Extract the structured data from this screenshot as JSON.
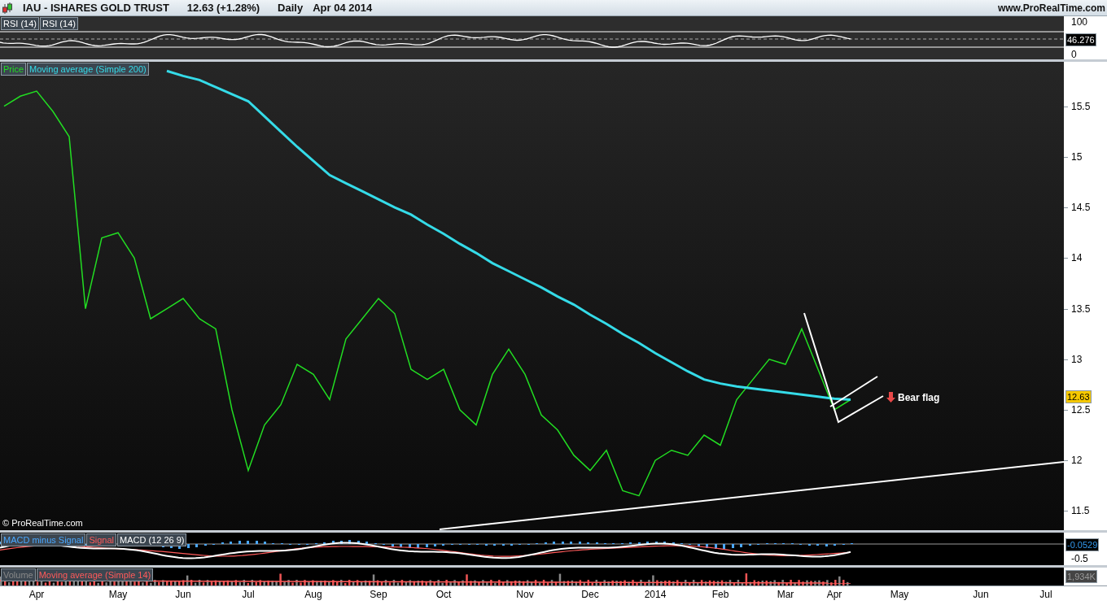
{
  "header": {
    "symbol": "IAU - ISHARES GOLD TRUST",
    "quote": "12.63 (+1.28%)",
    "period": "Daily",
    "date": "Apr 04 2014",
    "site": "www.ProRealTime.com"
  },
  "rsi_panel": {
    "legend": [
      {
        "label": "RSI (14)",
        "color": "#ffffff"
      },
      {
        "label": "RSI (14)",
        "color": "#ffffff"
      }
    ],
    "axis_labels": [
      "100",
      "0"
    ],
    "readout": "46.276"
  },
  "price_panel": {
    "readout": "12.63",
    "copyright": "© ProRealTime.com",
    "chart_data": {
      "type": "line",
      "categories": [
        null,
        null,
        "Apr",
        null,
        null,
        null,
        null,
        "May",
        null,
        null,
        null,
        "Jun",
        null,
        null,
        null,
        "Jul",
        null,
        null,
        null,
        "Aug",
        null,
        null,
        null,
        "Sep",
        null,
        null,
        null,
        "Oct",
        null,
        null,
        null,
        null,
        "Nov",
        null,
        null,
        null,
        "Dec",
        null,
        null,
        null,
        "2014",
        null,
        null,
        null,
        "Feb",
        null,
        null,
        null,
        "Mar",
        null,
        null,
        "Apr",
        null,
        null,
        null,
        "May",
        null,
        null,
        null,
        null,
        "Jun",
        null,
        null,
        null,
        "Jul",
        null
      ],
      "series": [
        {
          "name": "Price",
          "color": "#22dd22",
          "values": [
            15.5,
            15.6,
            15.65,
            15.45,
            15.2,
            13.5,
            14.2,
            14.25,
            14.0,
            13.4,
            13.5,
            13.6,
            13.4,
            13.3,
            12.5,
            11.9,
            12.35,
            12.55,
            12.95,
            12.85,
            12.6,
            13.2,
            13.4,
            13.6,
            13.45,
            12.9,
            12.8,
            12.9,
            12.5,
            12.35,
            12.85,
            13.1,
            12.85,
            12.45,
            12.3,
            12.05,
            11.9,
            12.1,
            11.7,
            11.65,
            12.0,
            12.1,
            12.05,
            12.25,
            12.15,
            12.6,
            12.8,
            13.0,
            12.95,
            13.3,
            12.9,
            12.5,
            12.6,
            null,
            null,
            null,
            null,
            null,
            null,
            null,
            null,
            null,
            null,
            null,
            null,
            null
          ]
        },
        {
          "name": "Moving average (Simple 200)",
          "color": "#35dbe8",
          "values": [
            null,
            null,
            null,
            null,
            null,
            null,
            null,
            null,
            null,
            null,
            15.85,
            15.8,
            15.76,
            15.69,
            15.62,
            15.55,
            15.4,
            15.25,
            15.1,
            14.96,
            14.82,
            14.74,
            14.66,
            14.58,
            14.5,
            14.43,
            14.33,
            14.24,
            14.14,
            14.05,
            13.95,
            13.87,
            13.79,
            13.71,
            13.62,
            13.54,
            13.44,
            13.35,
            13.25,
            13.16,
            13.06,
            12.97,
            12.88,
            12.8,
            12.76,
            12.73,
            12.71,
            12.69,
            12.67,
            12.65,
            12.63,
            12.61,
            12.6,
            null,
            null,
            null,
            null,
            null,
            null,
            null,
            null,
            null,
            null,
            null,
            null,
            null
          ]
        }
      ],
      "ylim": [
        11.31,
        15.94
      ],
      "yticks": [
        15.5,
        15,
        14.5,
        14,
        13.5,
        13,
        12.5,
        12,
        11.5
      ],
      "annotations": [
        "Bear flag"
      ]
    }
  },
  "macd_panel": {
    "legend": [
      {
        "label": "MACD minus Signal",
        "color": "#4aa8ff"
      },
      {
        "label": "Signal",
        "color": "#ff5a5a"
      },
      {
        "label": "MACD (12 26 9)",
        "color": "#ffffff"
      }
    ],
    "readout": "-0.0529",
    "axis_labels": [
      "-0.5"
    ]
  },
  "volume_panel": {
    "legend": [
      {
        "label": "Volume",
        "color": "#888888"
      },
      {
        "label": "Moving average (Simple 14)",
        "color": "#ff5a5a"
      }
    ],
    "readout": "1,934K"
  }
}
